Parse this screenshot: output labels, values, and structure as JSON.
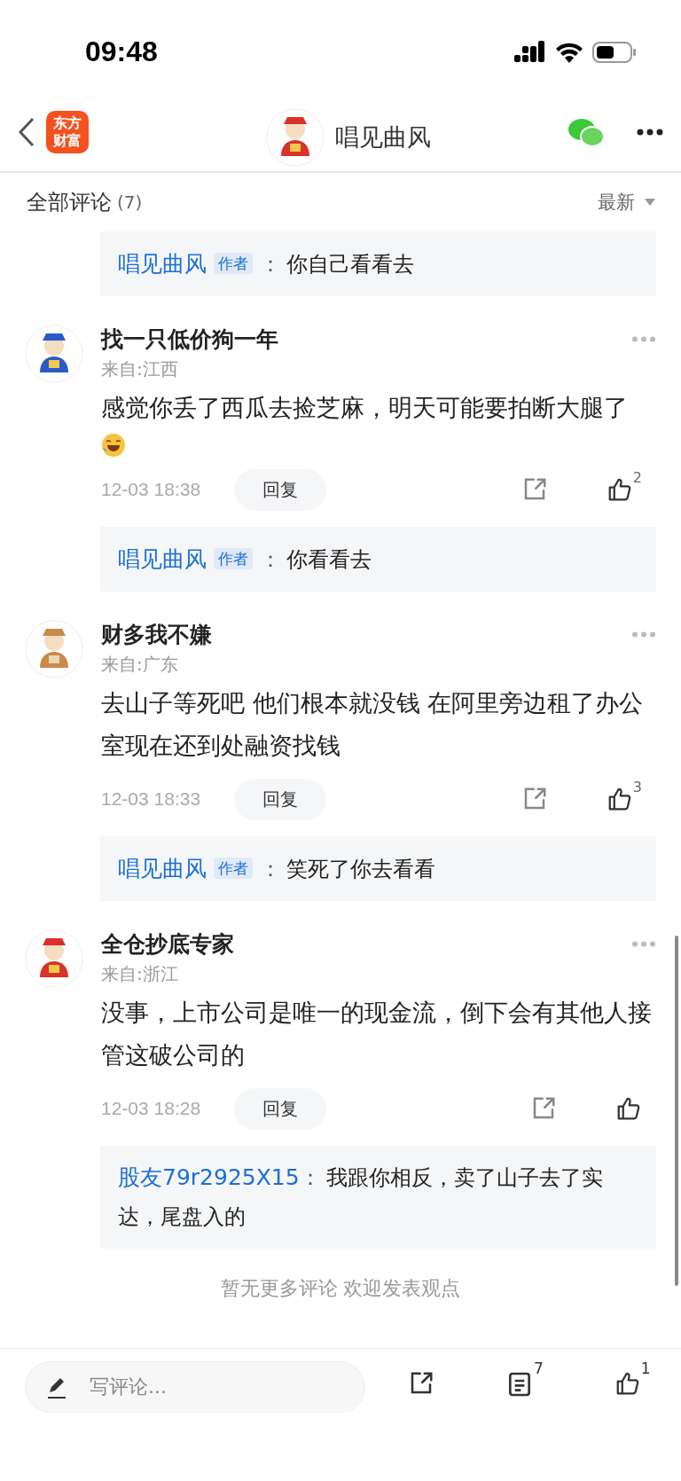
{
  "status_bar": {
    "time": "09:48"
  },
  "nav": {
    "logo_lines": [
      "东方",
      "财富"
    ],
    "title": "唱见曲风"
  },
  "header": {
    "title": "全部评论",
    "count": "(7)",
    "sort": "最新"
  },
  "earlier_replies": [
    {
      "author": "唱见曲风",
      "badge": "作者",
      "sep": "：",
      "text": "你自己看看去"
    }
  ],
  "comments": [
    {
      "author": "找一只低价狗一年",
      "location": "来自:江西",
      "text": "感觉你丢了西瓜去捡芝麻，明天可能要拍断大腿了",
      "emoji": true,
      "time": "12-03 18:38",
      "reply_label": "回复",
      "likes": "2",
      "replies": [
        {
          "author": "唱见曲风",
          "badge": "作者",
          "sep": "：",
          "text": "你看看去"
        }
      ]
    },
    {
      "author": "财多我不嫌",
      "location": "来自:广东",
      "text": "去山子等死吧 他们根本就没钱 在阿里旁边租了办公室现在还到处融资找钱",
      "emoji": false,
      "time": "12-03 18:33",
      "reply_label": "回复",
      "likes": "3",
      "replies": [
        {
          "author": "唱见曲风",
          "badge": "作者",
          "sep": "：",
          "text": "笑死了你去看看"
        }
      ]
    },
    {
      "author": "全仓抄底专家",
      "location": "来自:浙江",
      "text": "没事，上市公司是唯一的现金流，倒下会有其他人接管这破公司的",
      "emoji": false,
      "time": "12-03 18:28",
      "reply_label": "回复",
      "replies": [
        {
          "author": "股友79r2925X15",
          "sep": "：",
          "text": "我跟你相反，卖了山子去了实达，尾盘入的"
        }
      ]
    }
  ],
  "end_note": "暂无更多评论  欢迎发表观点",
  "bottom_bar": {
    "placeholder": "写评论...",
    "comment_count": "7",
    "like_count": "1"
  }
}
